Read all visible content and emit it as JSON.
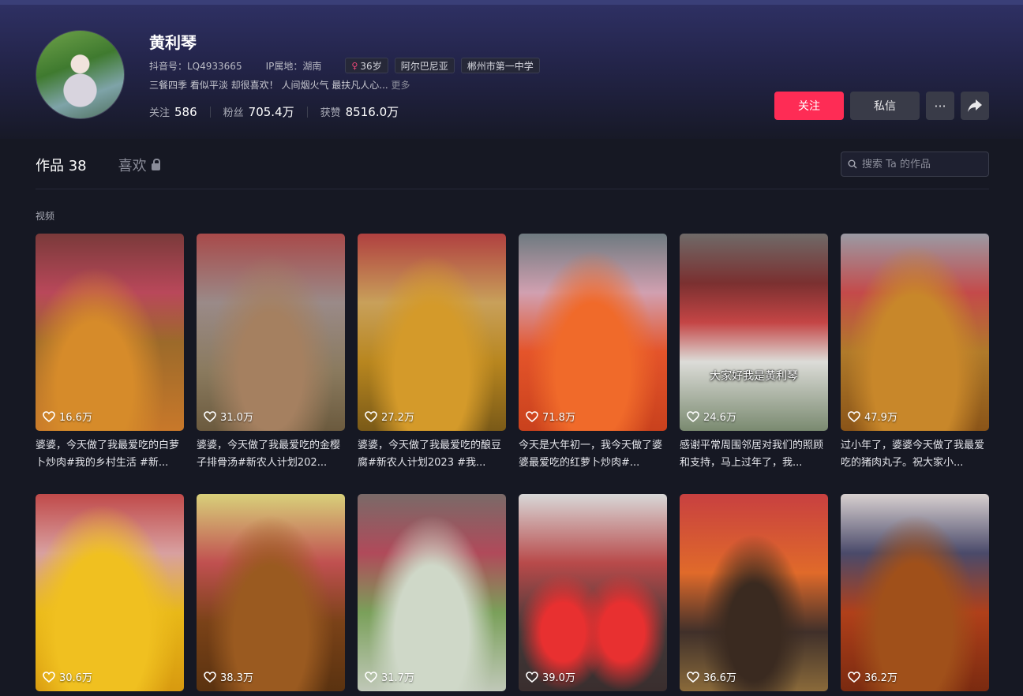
{
  "profile": {
    "name": "黄利琴",
    "douyin_id": "抖音号：LQ4933665",
    "ip_location": "IP属地：湖南",
    "age_tag": "36岁",
    "tags": [
      "阿尔巴尼亚",
      "郴州市第一中学"
    ],
    "bio": "三餐四季 看似平淡 却很喜欢！ 人间烟火气 最扶凡人心...",
    "bio_more": "更多",
    "stats": {
      "following_label": "关注",
      "following": "586",
      "followers_label": "粉丝",
      "followers": "705.4万",
      "likes_label": "获赞",
      "likes": "8516.0万"
    }
  },
  "actions": {
    "follow": "关注",
    "message": "私信",
    "more": "···"
  },
  "tabs": {
    "works_label": "作品",
    "works_count": "38",
    "likes_label": "喜欢"
  },
  "search": {
    "placeholder": "搜索 Ta 的作品"
  },
  "section_label": "视频",
  "videos": [
    {
      "likes": "16.6万",
      "title": "婆婆，今天做了我最爱吃的白萝卜炒肉#我的乡村生活 #新..."
    },
    {
      "likes": "31.0万",
      "title": "婆婆，今天做了我最爱吃的金樱子排骨汤#新农人计划202..."
    },
    {
      "likes": "27.2万",
      "title": "婆婆，今天做了我最爱吃的酿豆腐#新农人计划2023 #我..."
    },
    {
      "likes": "71.8万",
      "title": "今天是大年初一，我今天做了婆婆最爱吃的红萝卜炒肉#..."
    },
    {
      "likes": "24.6万",
      "title": "感谢平常周围邻居对我们的照顾和支持，马上过年了，我...",
      "overlay": "大家好我是黄利琴"
    },
    {
      "likes": "47.9万",
      "title": "过小年了，婆婆今天做了我最爱吃的猪肉丸子。祝大家小..."
    },
    {
      "likes": "30.6万",
      "title": ""
    },
    {
      "likes": "38.3万",
      "title": ""
    },
    {
      "likes": "31.7万",
      "title": ""
    },
    {
      "likes": "39.0万",
      "title": ""
    },
    {
      "likes": "36.6万",
      "title": ""
    },
    {
      "likes": "36.2万",
      "title": ""
    }
  ],
  "colors": {
    "accent": "#fe2c55",
    "background": "#161823"
  }
}
